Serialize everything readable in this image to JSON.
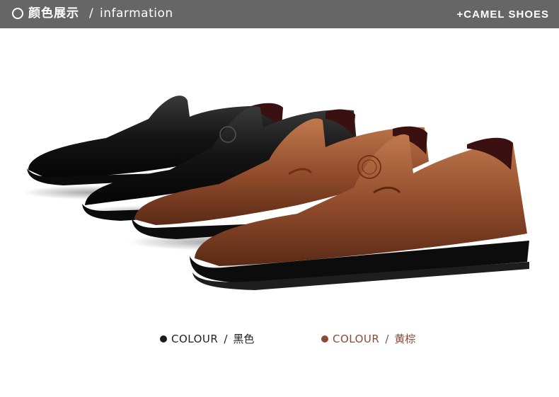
{
  "header": {
    "title_zh": "颜色展示",
    "separator": "/",
    "title_en": "infarmation",
    "brand": "+CAMEL SHOES",
    "icon": "circle-outline-icon"
  },
  "colors": {
    "header_bg": "#666666",
    "black_dot": "#1a1a1a",
    "brown_dot": "#8a4a35",
    "brown_text": "#8a4a35",
    "black_text": "#222222"
  },
  "swatches": [
    {
      "label": "COLOUR",
      "separator": "/",
      "name": "黑色",
      "dot_color": "#1a1a1a"
    },
    {
      "label": "COLOUR",
      "separator": "/",
      "name": "黄棕",
      "dot_color": "#8a4a35"
    }
  ]
}
